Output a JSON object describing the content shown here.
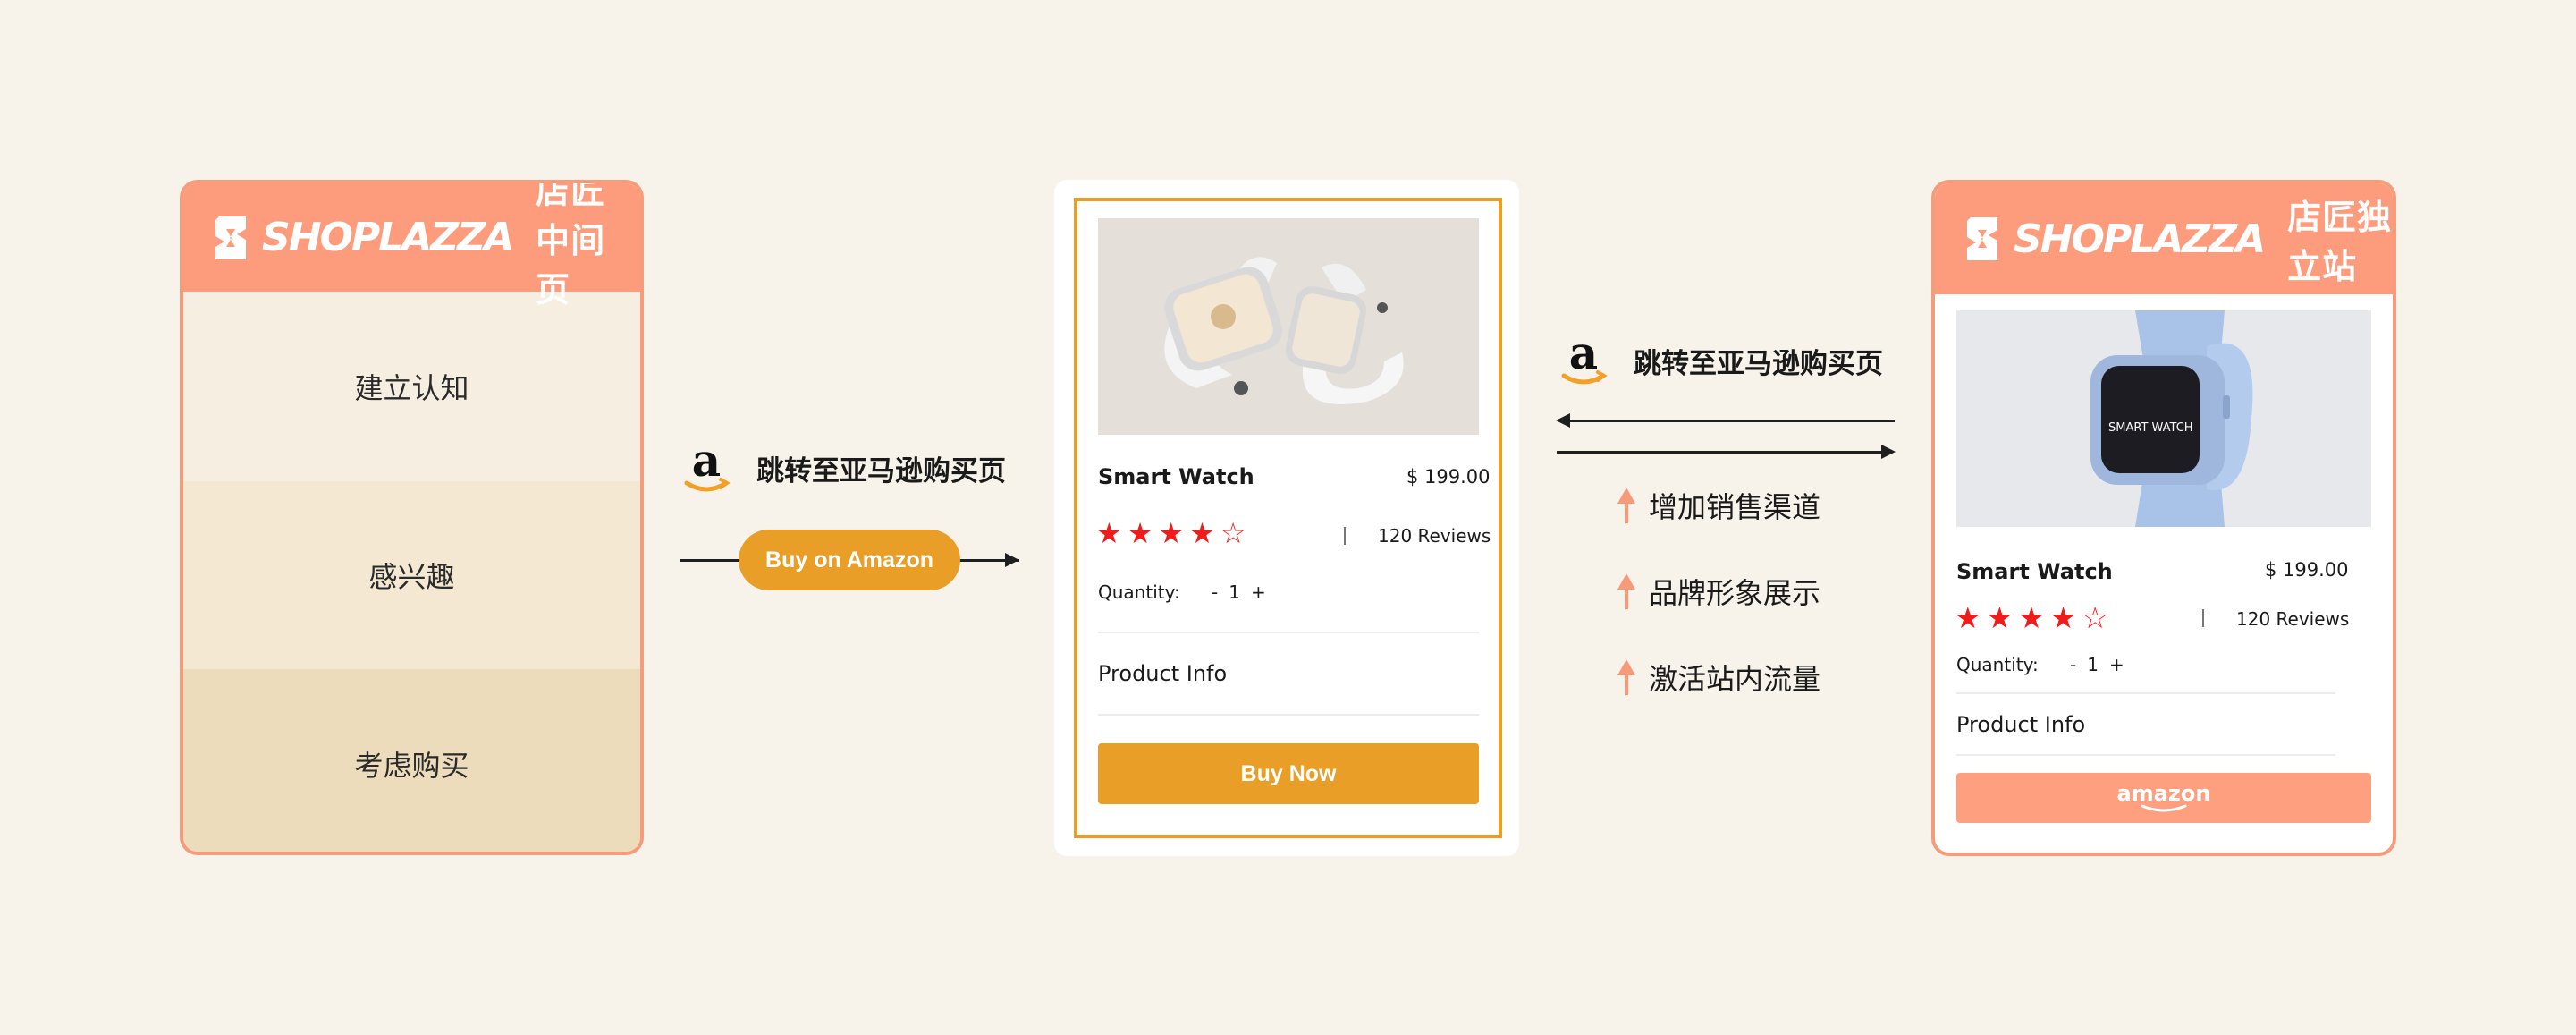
{
  "left_card": {
    "brand": "SHOPLAZZA",
    "title": "店匠中间页",
    "stages": [
      "建立认知",
      "感兴趣",
      "考虑购买"
    ]
  },
  "flow_left": {
    "amazon_logo": "a",
    "jump_label": "跳转至亚马逊购买页",
    "button_label": "Buy on Amazon"
  },
  "middle_card": {
    "product_name": "Smart Watch",
    "price": "$ 199.00",
    "rating": 4,
    "rating_max": 5,
    "reviews": "120 Reviews",
    "quantity_label": "Quantity:",
    "quantity_minus": "-",
    "quantity_value": "1",
    "quantity_plus": "+",
    "product_info": "Product Info",
    "buy_label": "Buy Now"
  },
  "flow_right": {
    "amazon_logo": "a",
    "jump_label": "跳转至亚马逊购买页",
    "benefits": [
      "增加销售渠道",
      "品牌形象展示",
      "激活站内流量"
    ]
  },
  "right_card": {
    "brand": "SHOPLAZZA",
    "title": "店匠独立站",
    "product_name": "Smart Watch",
    "price": "$ 199.00",
    "rating": 4,
    "rating_max": 5,
    "reviews": "120 Reviews",
    "quantity_label": "Quantity:",
    "quantity_minus": "-",
    "quantity_value": "1",
    "quantity_plus": "+",
    "product_info": "Product Info",
    "amazon_button": "amazon",
    "watch_screen": "SMART WATCH"
  },
  "colors": {
    "background": "#f8f3ea",
    "coral": "#fd9c7c",
    "orange": "#e89e27",
    "star_red": "#ef1c1c",
    "arrow_coral": "#f79a77"
  }
}
